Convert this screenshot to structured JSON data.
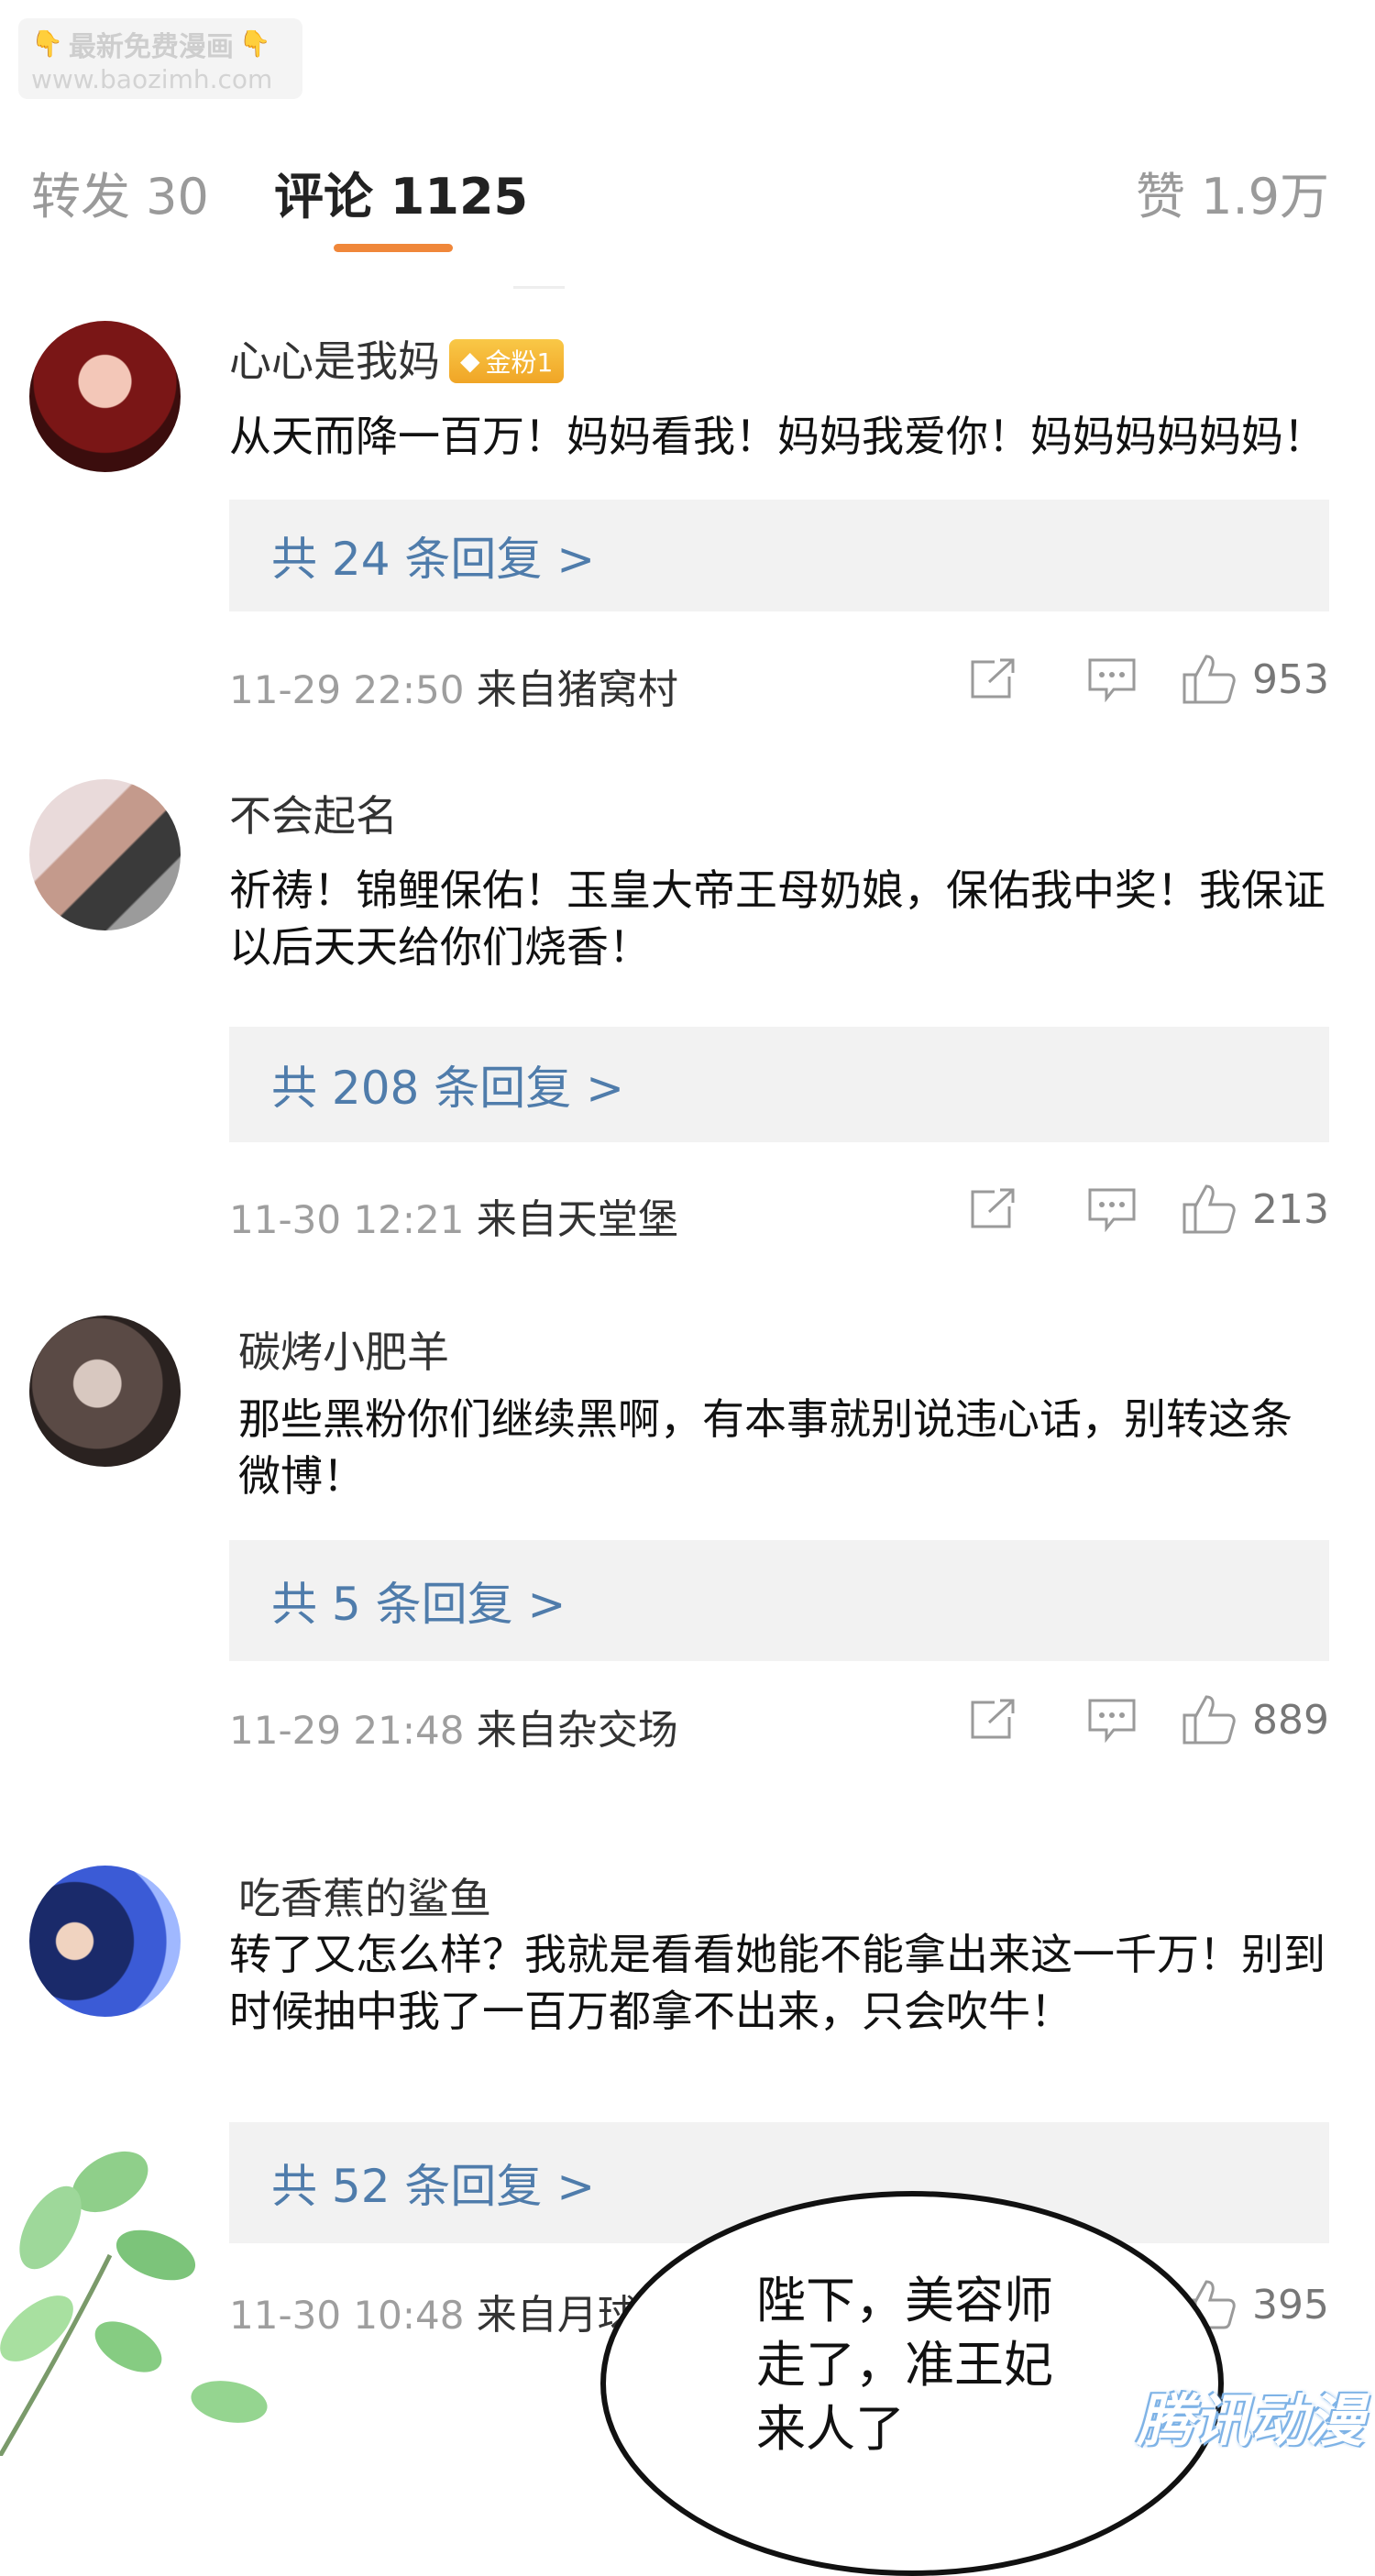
{
  "watermark": {
    "line1": "最新免费漫画",
    "line2": "www.baozimh.com"
  },
  "tabs": {
    "repost": "转发 30",
    "comments": "评论 1125",
    "likes": "赞 1.9万"
  },
  "comments": [
    {
      "username": "心心是我妈",
      "badge": "金粉1",
      "text": "从天而降一百万！妈妈看我！妈妈我爱你！妈妈妈妈妈妈！",
      "replies": "共 24 条回复 >",
      "time": "11-29 22:50",
      "source": "来自猪窝村",
      "likes": "953"
    },
    {
      "username": "不会起名",
      "text": "祈祷！锦鲤保佑！玉皇大帝王母奶娘，保佑我中奖！我保证以后天天给你们烧香！",
      "replies": "共 208 条回复 >",
      "time": "11-30 12:21",
      "source": "来自天堂堡",
      "likes": "213"
    },
    {
      "username": "碳烤小肥羊",
      "text": "那些黑粉你们继续黑啊，有本事就别说违心话，别转这条微博！",
      "replies": "共 5 条回复 >",
      "time": "11-29 21:48",
      "source": "来自杂交场",
      "likes": "889"
    },
    {
      "username": "吃香蕉的鲨鱼",
      "text": "转了又怎么样？我就是看看她能不能拿出来这一千万！别到时候抽中我了一百万都拿不出来，只会吹牛！",
      "replies": "共 52 条回复 >",
      "time": "11-30 10:48",
      "source": "来自月球",
      "likes": "395"
    }
  ],
  "bubble": {
    "line1": "陛下，美容师",
    "line2": "走了，准王妃",
    "line3": "来人了"
  },
  "logo": "腾讯动漫"
}
